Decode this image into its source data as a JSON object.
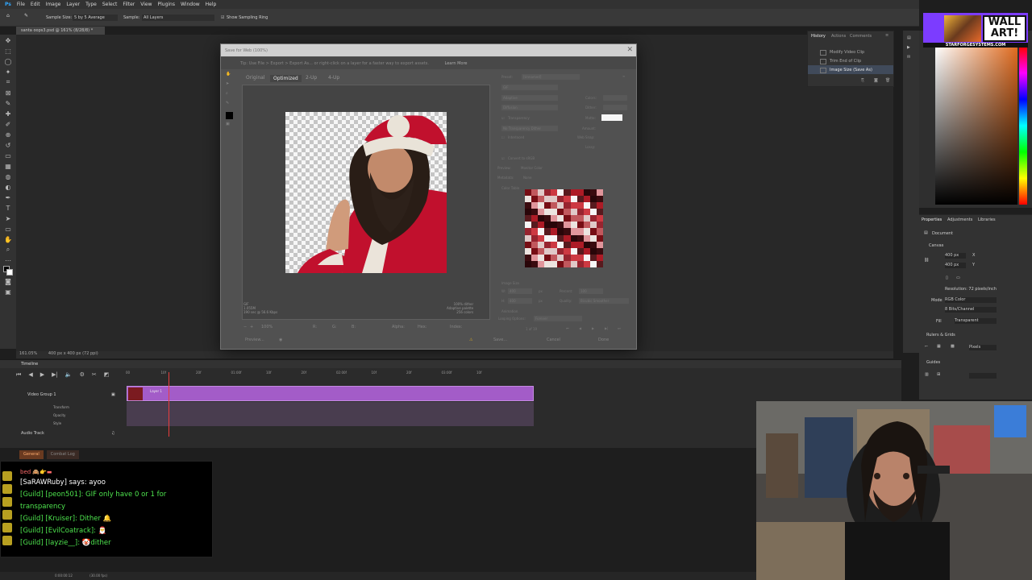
{
  "menubar": {
    "items": [
      "File",
      "Edit",
      "Image",
      "Layer",
      "Type",
      "Select",
      "Filter",
      "View",
      "Plugins",
      "Window",
      "Help"
    ]
  },
  "optionsbar": {
    "sample_size_label": "Sample Size:",
    "sample_size_value": "5 by 5 Average",
    "sample_label": "Sample:",
    "sample_value": "All Layers",
    "show_ring_label": "Show Sampling Ring"
  },
  "document": {
    "tab_title": "santa oops3.psd @ 161% (8/28/8) *",
    "zoom_status": "161.05%",
    "size_status": "400 px x 400 px (72 ppi)"
  },
  "dialog": {
    "title": "Save for Web (100%)",
    "hint": "Tip: Use File > Export > Export As... or right-click on a layer for a faster way to export assets.",
    "learn_more": "Learn More",
    "tabs": [
      "Original",
      "Optimized",
      "2-Up",
      "4-Up"
    ],
    "preset_label": "Preset:",
    "preset_value": "[Unnamed]",
    "format": "GIF",
    "reduction": "Adaptive",
    "dither_algo": "Diffusion",
    "colors_label": "Colors:",
    "dither_label": "Dither:",
    "transparency": "Transparency",
    "matte_label": "Matte:",
    "trans_dither": "No Transparency Dither",
    "amount_label": "Amount:",
    "interlaced": "Interlaced",
    "web_snap_label": "Web Snap:",
    "lossy_label": "Lossy:",
    "convert_srgb": "Convert to sRGB",
    "preview_label": "Preview:",
    "preview_value": "Monitor Color",
    "metadata_label": "Metadata:",
    "metadata_value": "None",
    "color_table_label": "Color Table",
    "image_size_label": "Image Size",
    "w_label": "W:",
    "w_value": "400",
    "h_label": "H:",
    "h_value": "400",
    "px": "px",
    "percent_label": "Percent:",
    "percent_value": "100",
    "quality_label": "Quality:",
    "quality_value": "Bicubic Smoother",
    "animation_label": "Animation",
    "looping_label": "Looping Options:",
    "looping_value": "Forever",
    "frame_counter": "1 of 19",
    "info_left": [
      "GIF",
      "1.055M",
      "190 sec @ 56.6 Kbps"
    ],
    "info_right": [
      "100% dither",
      "Adaptive palette",
      "256 colors"
    ],
    "zoom": "100%",
    "r_label": "R:",
    "g_label": "G:",
    "b_label": "B:",
    "alpha_label": "Alpha:",
    "hex_label": "Hex:",
    "index_label": "Index:",
    "preview_btn": "Preview...",
    "save_btn": "Save...",
    "cancel_btn": "Cancel",
    "done_btn": "Done"
  },
  "history": {
    "tabs": [
      "History",
      "Actions",
      "Comments"
    ],
    "items": [
      "Modify Video Clip",
      "Trim End of Clip",
      "Image Size (Save As)"
    ],
    "selected_index": 2
  },
  "properties": {
    "tabs": [
      "Properties",
      "Adjustments",
      "Libraries"
    ],
    "document_label": "Document",
    "canvas_label": "Canvas",
    "w_value": "400 px",
    "h_value": "400 px",
    "x_label": "X",
    "y_label": "Y",
    "resolution": "Resolution: 72 pixels/inch",
    "mode_label": "Mode",
    "mode_value": "RGB Color",
    "depth_value": "8 Bits/Channel",
    "fill_label": "Fill",
    "fill_value": "Transparent",
    "rulers_label": "Rulers & Grids",
    "units_value": "Pixels",
    "guides_label": "Guides"
  },
  "branding": {
    "text_line1": "WALL",
    "text_line2": "ART!",
    "url": "STARFORGESYSTEMS.COM"
  },
  "timeline": {
    "title": "Timeline",
    "group_label": "Video Group 1",
    "layer_label": "Layer 1",
    "rows": [
      "Transform",
      "Opacity",
      "Style"
    ],
    "audio_label": "Audio Track",
    "ruler": [
      "00",
      "10f",
      "20f",
      "01:00f",
      "10f",
      "20f",
      "02:00f",
      "10f",
      "20f",
      "03:00f",
      "10f"
    ],
    "timecode": "0:00:00:12",
    "fps": "(30.00 fps)"
  },
  "chat": {
    "tabs": [
      "General",
      "Combat Log"
    ],
    "active_tab": 0,
    "lines": [
      {
        "kind": "red",
        "text": "bed 🙈👉▬"
      },
      {
        "kind": "say",
        "text": "[SaRAWRuby] says: ayoo"
      },
      {
        "kind": "guild",
        "text": "[Guild] [peon501]: GIF only have 0 or 1 for transparency"
      },
      {
        "kind": "guild",
        "text": "[Guild] [Kruiser]: Dither 🔔"
      },
      {
        "kind": "guild",
        "text": "[Guild] [EvilCoatrack]: 🎅"
      },
      {
        "kind": "guild",
        "text": "[Guild] [layzie__]: 🤡dither"
      }
    ]
  },
  "colors": {
    "accent": "#a35cc8",
    "playhead": "#e83d3d",
    "guild_green": "#4ee44e",
    "brand_purple": "#7c3cff",
    "picker_orange": "#e06b1f"
  }
}
